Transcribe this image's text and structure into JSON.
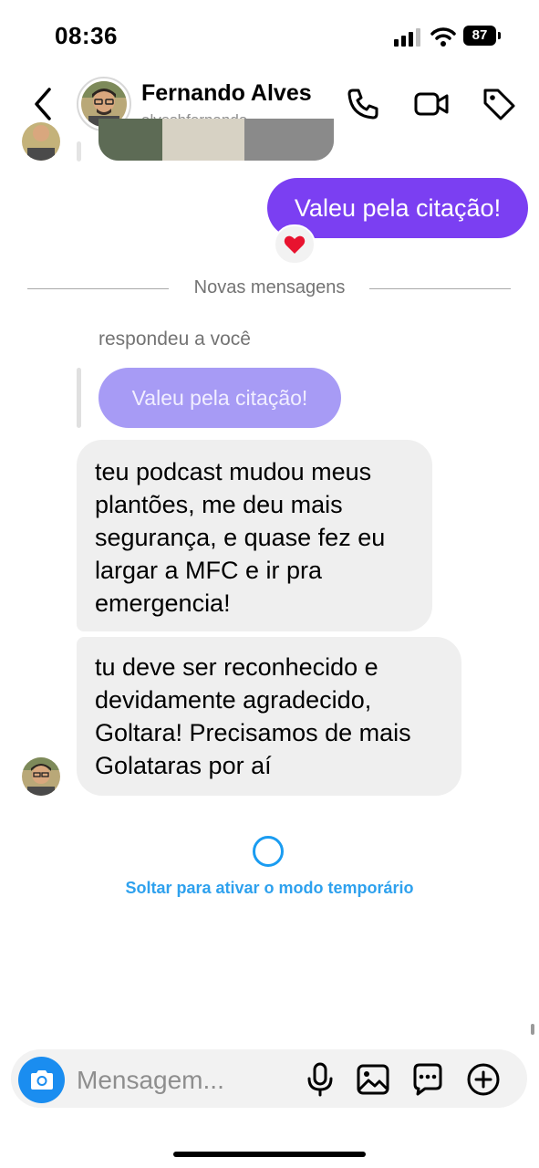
{
  "status_bar": {
    "time": "08:36",
    "battery": "87"
  },
  "header": {
    "name": "Fernando Alves",
    "username": "alveshfernando",
    "icons": [
      "back-chevron-icon",
      "phone-icon",
      "video-camera-icon",
      "tag-icon"
    ]
  },
  "messages": {
    "outgoing_text": "Valeu pela citação!",
    "reaction": "❤️",
    "divider_label": "Novas mensagens",
    "reply_context": "respondeu a você",
    "quoted_text": "Valeu pela citação!",
    "incoming": [
      {
        "lines": [
          "teu podcast mudou meus",
          "plantões, me deu mais",
          "segurança, e quase fez eu",
          "largar a MFC e ir pra",
          "emergencia!"
        ]
      },
      {
        "lines": [
          "tu deve ser reconhecido e",
          "devidamente agradecido,",
          "Goltara! Precisamos de mais",
          "Golataras por aí"
        ]
      }
    ]
  },
  "temporary_mode": {
    "label": "Soltar para ativar o modo temporário"
  },
  "composer": {
    "placeholder": "Mensagem...",
    "icons": [
      "camera-icon",
      "microphone-icon",
      "gallery-icon",
      "sticker-chat-icon",
      "plus-icon"
    ]
  },
  "colors": {
    "outgoing_bubble": "#7b3ff2",
    "quoted_bubble": "#a79bf5",
    "incoming_bubble": "#efefef",
    "accent_blue": "#1a8df0",
    "temp_text": "#2ea1ee"
  }
}
